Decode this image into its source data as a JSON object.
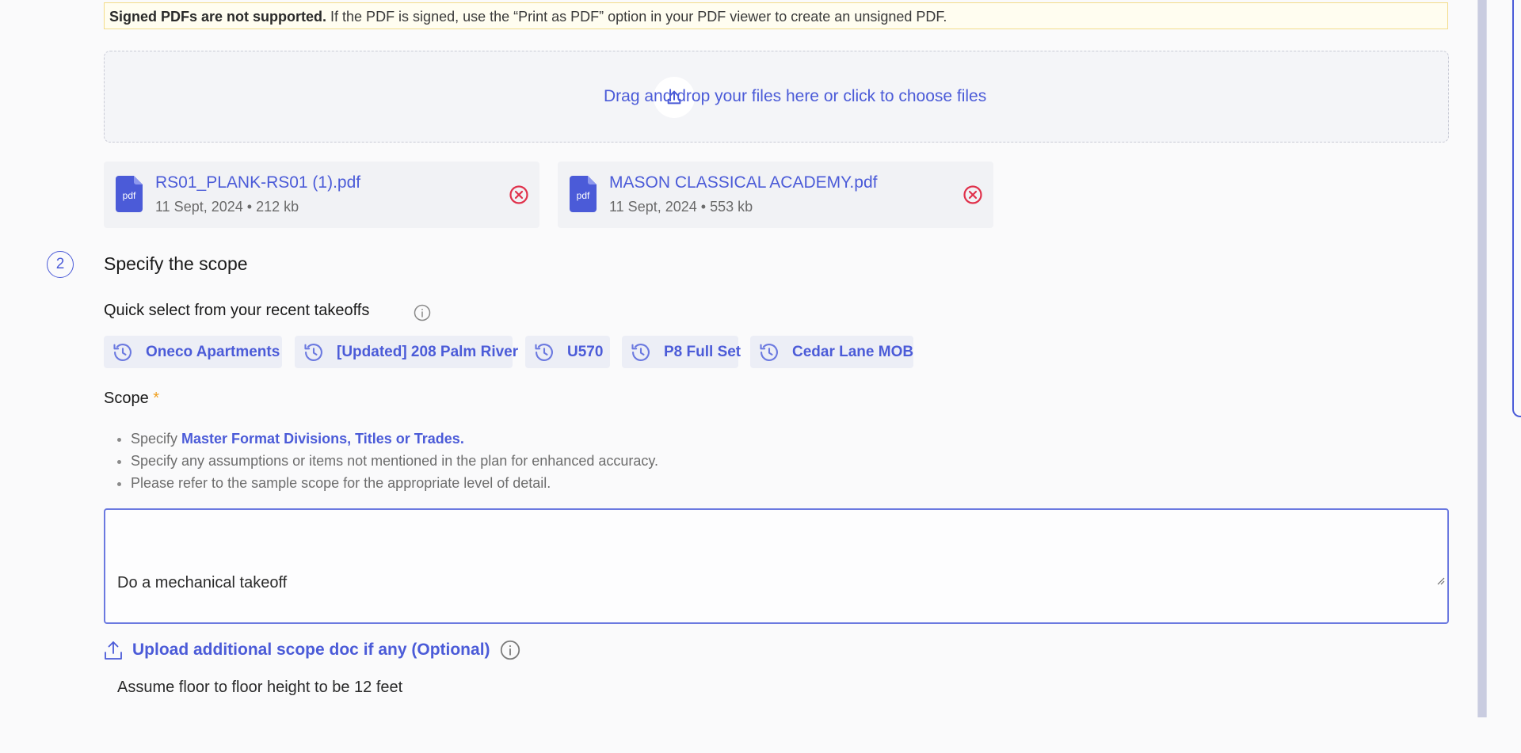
{
  "notice": {
    "bold": "Signed PDFs are not supported.",
    "text": " If the PDF is signed, use the “Print as PDF” option in your PDF viewer to create an unsigned PDF."
  },
  "dropzone": {
    "text": "Drag and drop your files here or click to choose files",
    "icon": "upload-icon"
  },
  "files": [
    {
      "name": "RS01_PLANK-RS01 (1).pdf",
      "meta": "11 Sept, 2024 • 212 kb",
      "icon_label": "pdf"
    },
    {
      "name": "MASON CLASSICAL ACADEMY.pdf",
      "meta": "11 Sept, 2024 • 553 kb",
      "icon_label": "pdf"
    }
  ],
  "step": {
    "number": "2",
    "title": "Specify the scope"
  },
  "quick_select": {
    "title": "Quick select from your recent takeoffs",
    "chips": [
      {
        "label": "Oneco Apartments"
      },
      {
        "label": "[Updated] 208 Palm River"
      },
      {
        "label": "U570"
      },
      {
        "label": "P8 Full Set"
      },
      {
        "label": "Cedar Lane MOB"
      }
    ]
  },
  "scope": {
    "label": "Scope",
    "required_mark": "*",
    "bullets": {
      "b1_prefix": "Specify ",
      "b1_link": "Master Format Divisions, Titles or Trades.",
      "b2": "Specify any assumptions or items not mentioned in the plan for enhanced accuracy.",
      "b3": "Please refer to the sample scope for the appropriate level of detail."
    },
    "value_line1": "Do a mechanical takeoff",
    "value_line2": "Assume floor to floor height to be 12 feet"
  },
  "upload_scope": {
    "label": "Upload additional scope doc if any (Optional)"
  },
  "colors": {
    "accent": "#4b5bd8",
    "remove": "#e0314b",
    "notice_bg": "#fffdf0"
  }
}
